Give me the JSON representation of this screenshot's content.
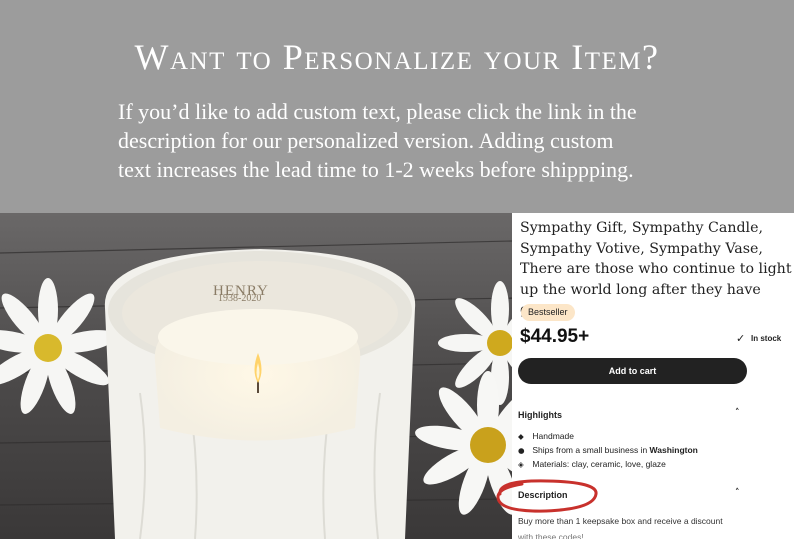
{
  "banner": {
    "title": "Want to Personalize your Item?",
    "line1": "If you’d like to add custom text, please click the link in the",
    "line2": "description for our personalized version. Adding custom",
    "line3": "text increases the lead time to 1-2 weeks before shippping."
  },
  "photo": {
    "engraving_name": "HENRY",
    "engraving_dates": "1938-2020"
  },
  "product": {
    "title_line1": "Sympathy Gift, Sympathy Candle,",
    "title_line2": "Sympathy Votive, Sympathy Vase,",
    "title_line3": "There are those who continue to light",
    "title_line4": "up the world long after they have gone",
    "badge": "Bestseller",
    "price": "$44.95+",
    "stock_icon": "check-icon",
    "stock": "In stock",
    "add_to_cart": "Add to cart"
  },
  "highlights": {
    "heading": "Highlights",
    "items": [
      {
        "icon": "tag-icon",
        "text": "Handmade"
      },
      {
        "icon": "location-pin-icon",
        "text_prefix": "Ships from a small business in ",
        "text_bold": "Washington"
      },
      {
        "icon": "materials-icon",
        "text": "Materials: clay, ceramic, love, glaze"
      }
    ]
  },
  "description": {
    "heading": "Description",
    "line1": "Buy more than 1 keepsake box and receive a discount",
    "line2": "with these codes!"
  },
  "colors": {
    "banner_bg": "#9c9c9c",
    "button_bg": "#222222",
    "badge_bg": "#fce6c8",
    "annotation": "#c8312c"
  }
}
